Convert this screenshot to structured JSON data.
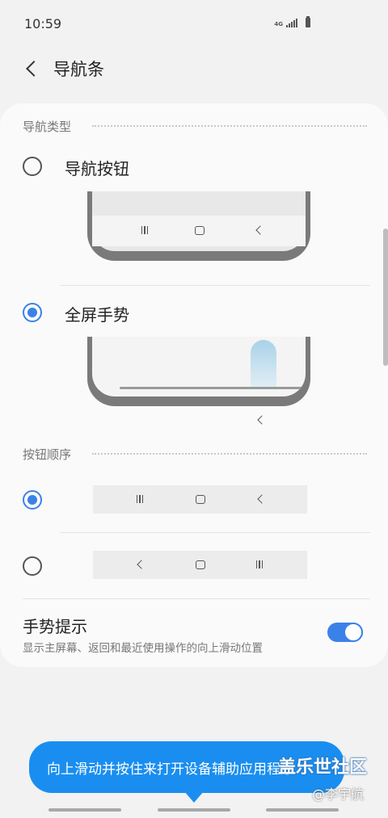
{
  "status_bar": {
    "time": "10:59",
    "network": "4G"
  },
  "header": {
    "title": "导航条"
  },
  "nav_type": {
    "section_title": "导航类型",
    "options": [
      {
        "label": "导航按钮",
        "selected": false
      },
      {
        "label": "全屏手势",
        "selected": true
      }
    ]
  },
  "button_order": {
    "section_title": "按钮顺序",
    "options": [
      {
        "selected": true,
        "icons": [
          "recent-apps-icon",
          "home-icon",
          "back-icon"
        ]
      },
      {
        "selected": false,
        "icons": [
          "back-icon",
          "home-icon",
          "recent-apps-icon"
        ]
      }
    ]
  },
  "gesture_hint_setting": {
    "title": "手势提示",
    "description": "显示主屏幕、返回和最近使用操作的向上滑动位置",
    "enabled": true
  },
  "tooltip": {
    "text": "向上滑动并按住来打开设备辅助应用程序"
  },
  "watermark": {
    "title": "盖乐世社区",
    "author": "@李宇航"
  },
  "colors": {
    "accent": "#3b82e8",
    "tooltip": "#1a8ef0",
    "background": "#f2f2f2",
    "card": "#fafafa"
  }
}
